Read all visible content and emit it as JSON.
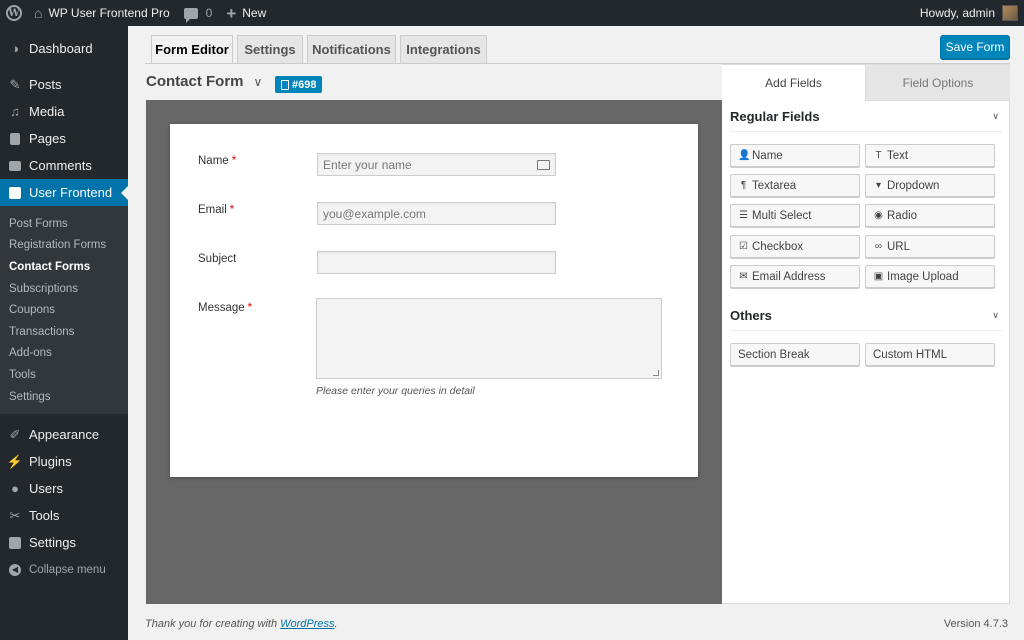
{
  "adminbar": {
    "site_name": "WP User Frontend Pro",
    "comments_count": "0",
    "new_label": "New",
    "greeting": "Howdy, admin"
  },
  "sidebar": {
    "items_top": [
      {
        "label": "Dashboard",
        "icon": "dashboard-icon"
      },
      {
        "label": "Posts",
        "icon": "pin-icon"
      },
      {
        "label": "Media",
        "icon": "media-icon"
      },
      {
        "label": "Pages",
        "icon": "pages-icon"
      },
      {
        "label": "Comments",
        "icon": "comment-icon"
      },
      {
        "label": "User Frontend",
        "icon": "form-icon"
      }
    ],
    "submenu": [
      "Post Forms",
      "Registration Forms",
      "Contact Forms",
      "Subscriptions",
      "Coupons",
      "Transactions",
      "Add-ons",
      "Tools",
      "Settings"
    ],
    "submenu_active": "Contact Forms",
    "items_bottom": [
      {
        "label": "Appearance",
        "icon": "brush-icon"
      },
      {
        "label": "Plugins",
        "icon": "plug-icon"
      },
      {
        "label": "Users",
        "icon": "users-icon"
      },
      {
        "label": "Tools",
        "icon": "wrench-icon"
      },
      {
        "label": "Settings",
        "icon": "settings-icon"
      }
    ],
    "collapse": "Collapse menu"
  },
  "tabs": [
    "Form Editor",
    "Settings",
    "Notifications",
    "Integrations"
  ],
  "active_tab": "Form Editor",
  "save_button": "Save Form",
  "form": {
    "title": "Contact Form",
    "id_badge": "#698",
    "fields": {
      "name_label": "Name",
      "name_placeholder": "Enter your name",
      "email_label": "Email",
      "email_placeholder": "you@example.com",
      "subject_label": "Subject",
      "message_label": "Message",
      "message_help": "Please enter your queries in detail",
      "required_mark": "*"
    }
  },
  "panel": {
    "tab_add": "Add Fields",
    "tab_options": "Field Options",
    "regular_title": "Regular Fields",
    "regular_fields": [
      {
        "label": "Name",
        "icon": "user-icon",
        "glyph": "👤"
      },
      {
        "label": "Text",
        "icon": "text-icon",
        "glyph": "T"
      },
      {
        "label": "Textarea",
        "icon": "paragraph-icon",
        "glyph": "¶"
      },
      {
        "label": "Dropdown",
        "icon": "dropdown-icon",
        "glyph": "▾"
      },
      {
        "label": "Multi Select",
        "icon": "list-icon",
        "glyph": "☰"
      },
      {
        "label": "Radio",
        "icon": "radio-icon",
        "glyph": "◉"
      },
      {
        "label": "Checkbox",
        "icon": "checkbox-icon",
        "glyph": "☑"
      },
      {
        "label": "URL",
        "icon": "link-icon",
        "glyph": "∞"
      },
      {
        "label": "Email Address",
        "icon": "envelope-icon",
        "glyph": "✉"
      },
      {
        "label": "Image Upload",
        "icon": "image-icon",
        "glyph": "▣"
      }
    ],
    "others_title": "Others",
    "other_fields": [
      {
        "label": "Section Break"
      },
      {
        "label": "Custom HTML"
      }
    ]
  },
  "footer": {
    "thanks_prefix": "Thank you for creating with ",
    "thanks_link": "WordPress",
    "thanks_suffix": ".",
    "version": "Version 4.7.3"
  },
  "colors": {
    "accent": "#0073aa",
    "button": "#0085ba",
    "sidebar_bg": "#23282d",
    "canvas_bg": "#676767",
    "required": "#dd0000"
  }
}
